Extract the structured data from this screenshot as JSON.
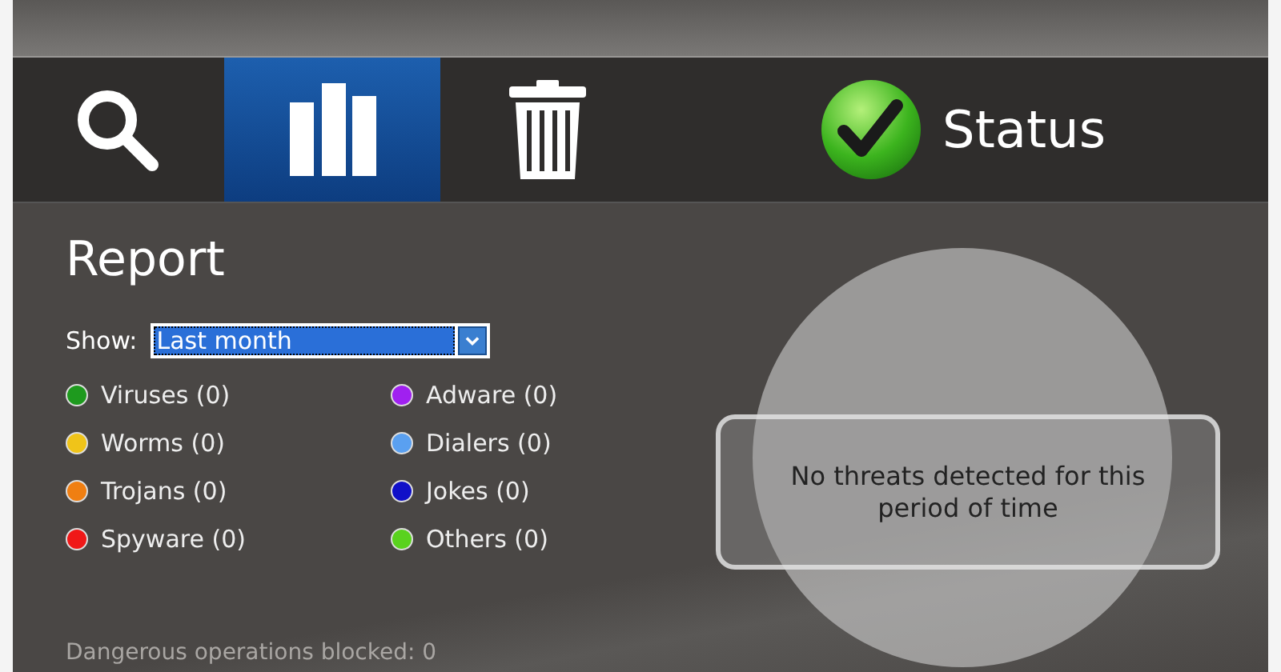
{
  "toolbar": {
    "tabs": [
      {
        "kind": "search",
        "selected": false
      },
      {
        "kind": "report",
        "selected": true
      },
      {
        "kind": "trash",
        "selected": false
      },
      {
        "kind": "status",
        "label": "Status",
        "selected": false
      }
    ]
  },
  "report": {
    "title": "Report",
    "show_label": "Show:",
    "show_value": "Last month",
    "legend": [
      {
        "label": "Viruses (0)",
        "color": "#1e9a1e"
      },
      {
        "label": "Worms (0)",
        "color": "#f0c419"
      },
      {
        "label": "Trojans (0)",
        "color": "#f07f12"
      },
      {
        "label": "Spyware (0)",
        "color": "#f01818"
      },
      {
        "label": "Adware (0)",
        "color": "#a020f0"
      },
      {
        "label": "Dialers (0)",
        "color": "#5aa0f0"
      },
      {
        "label": "Jokes (0)",
        "color": "#1010c8"
      },
      {
        "label": "Others (0)",
        "color": "#5ad21e"
      }
    ],
    "blocked": "Dangerous operations blocked: 0",
    "message": "No threats detected for this period of time"
  }
}
